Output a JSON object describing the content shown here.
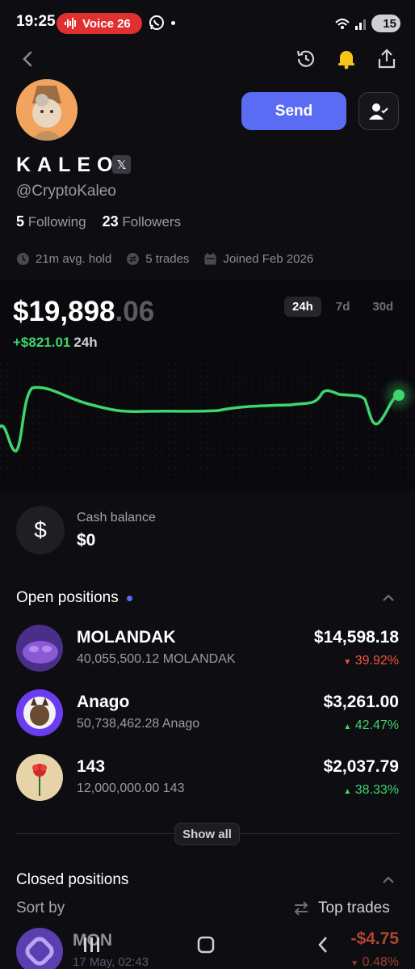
{
  "status_bar": {
    "time": "19:25",
    "voice_label": "Voice 26",
    "battery": "15"
  },
  "profile": {
    "name": "KALEO",
    "handle": "@CryptoKaleo",
    "following_count": "5",
    "following_label": "Following",
    "followers_count": "23",
    "followers_label": "Followers",
    "avg_hold": "21m avg. hold",
    "trades": "5 trades",
    "joined": "Joined Feb 2026",
    "send_label": "Send"
  },
  "portfolio": {
    "value_main": "$19,898",
    "value_cents": ".06",
    "change": "+$821.01",
    "change_period": "24h",
    "tabs": [
      "24h",
      "7d",
      "30d"
    ],
    "active_tab": "24h"
  },
  "cash": {
    "label": "Cash balance",
    "value": "$0"
  },
  "open_positions": {
    "title": "Open positions",
    "items": [
      {
        "name": "MOLANDAK",
        "amount": "40,055,500.12 MOLANDAK",
        "value": "$14,598.18",
        "pct": "39.92%",
        "direction": "down"
      },
      {
        "name": "Anago",
        "amount": "50,738,462.28 Anago",
        "value": "$3,261.00",
        "pct": "42.47%",
        "direction": "up"
      },
      {
        "name": "143",
        "amount": "12,000,000.00 143",
        "value": "$2,037.79",
        "pct": "38.33%",
        "direction": "up"
      }
    ],
    "show_all": "Show all"
  },
  "closed_positions": {
    "title": "Closed positions",
    "sort_label": "Sort by",
    "sort_value": "Top trades",
    "items": [
      {
        "name": "MON",
        "date": "17 May, 02:43",
        "value": "-$4.75",
        "pct": "0.48%"
      }
    ]
  },
  "colors": {
    "accent": "#5b6cf4",
    "positive": "#3dd56c",
    "negative": "#f0553a",
    "background": "#0e0e12"
  }
}
